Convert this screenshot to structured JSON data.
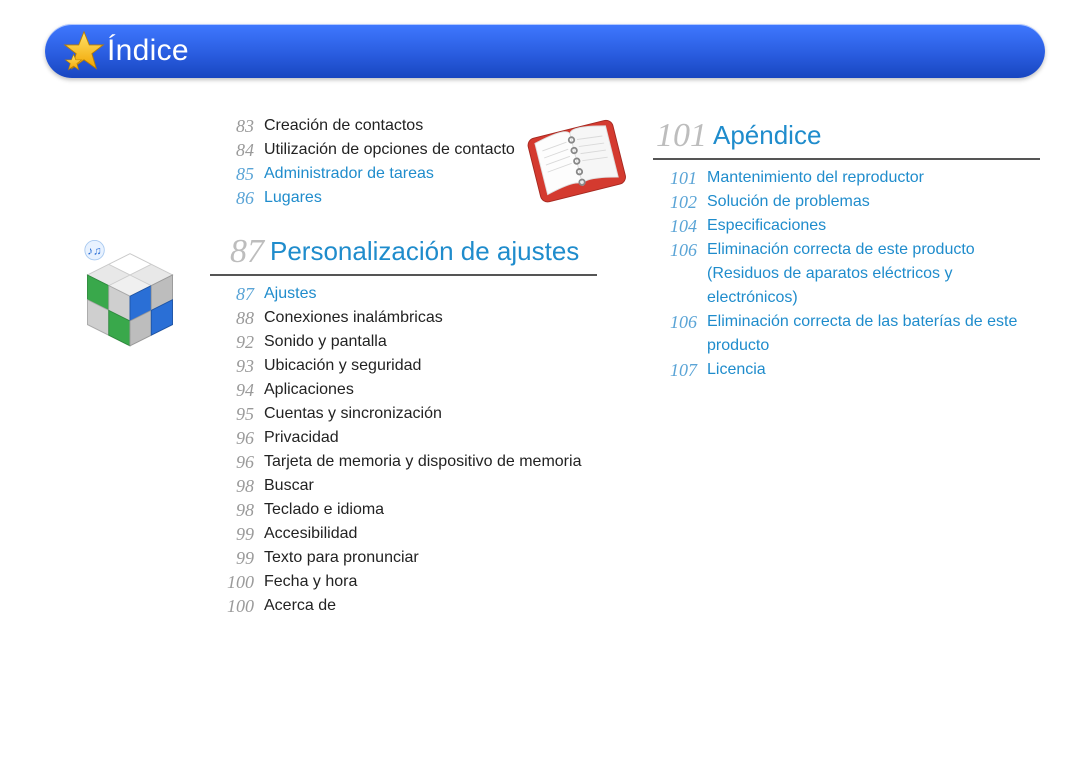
{
  "header": {
    "title": "Índice"
  },
  "left": {
    "top_entries": [
      {
        "page": "83",
        "text": "Creación de contactos",
        "link": false
      },
      {
        "page": "84",
        "text": "Utilización de opciones de contacto",
        "link": false
      },
      {
        "page": "85",
        "text": "Administrador de tareas",
        "link": true
      },
      {
        "page": "86",
        "text": "Lugares",
        "link": true
      }
    ],
    "chapter": {
      "page": "87",
      "title": "Personalización de ajustes"
    },
    "entries": [
      {
        "page": "87",
        "text": "Ajustes",
        "link": true
      },
      {
        "page": "88",
        "text": "Conexiones inalámbricas",
        "link": false
      },
      {
        "page": "92",
        "text": "Sonido y pantalla",
        "link": false
      },
      {
        "page": "93",
        "text": "Ubicación y seguridad",
        "link": false
      },
      {
        "page": "94",
        "text": "Aplicaciones",
        "link": false
      },
      {
        "page": "95",
        "text": "Cuentas y sincronización",
        "link": false
      },
      {
        "page": "96",
        "text": "Privacidad",
        "link": false
      },
      {
        "page": "96",
        "text": "Tarjeta de memoria y dispositivo de memoria",
        "link": false
      },
      {
        "page": "98",
        "text": "Buscar",
        "link": false
      },
      {
        "page": "98",
        "text": "Teclado e idioma",
        "link": false
      },
      {
        "page": "99",
        "text": "Accesibilidad",
        "link": false
      },
      {
        "page": "99",
        "text": "Texto para pronunciar",
        "link": false
      },
      {
        "page": "100",
        "text": "Fecha y hora",
        "link": false
      },
      {
        "page": "100",
        "text": "Acerca de",
        "link": false
      }
    ]
  },
  "right": {
    "chapter": {
      "page": "101",
      "title": "Apéndice"
    },
    "entries": [
      {
        "page": "101",
        "text": "Mantenimiento del reproductor",
        "link": true
      },
      {
        "page": "102",
        "text": "Solución de problemas",
        "link": true
      },
      {
        "page": "104",
        "text": "Especificaciones",
        "link": true
      },
      {
        "page": "106",
        "text": "Eliminación correcta de este producto (Residuos de aparatos eléctricos y electrónicos)",
        "link": true
      },
      {
        "page": "106",
        "text": "Eliminación correcta de las baterías de este producto",
        "link": true
      },
      {
        "page": "107",
        "text": "Licencia",
        "link": true
      }
    ]
  }
}
